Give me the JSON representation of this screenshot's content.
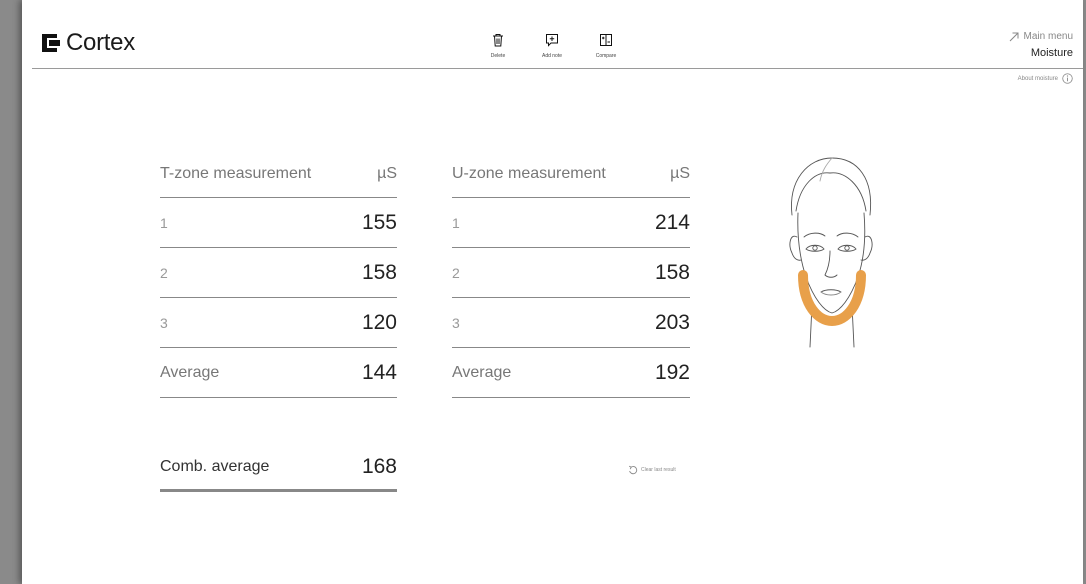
{
  "app": {
    "name": "Cortex"
  },
  "toolbar": {
    "delete_label": "Delete",
    "add_note_label": "Add note",
    "compare_label": "Compare"
  },
  "nav": {
    "main_menu_label": "Main menu",
    "page_title": "Moisture",
    "about_label": "About moisture"
  },
  "t_zone": {
    "title": "T-zone measurement",
    "unit": "µS",
    "rows": [
      {
        "label": "1",
        "value": "155"
      },
      {
        "label": "2",
        "value": "158"
      },
      {
        "label": "3",
        "value": "120"
      }
    ],
    "average_label": "Average",
    "average_value": "144"
  },
  "u_zone": {
    "title": "U-zone measurement",
    "unit": "µS",
    "rows": [
      {
        "label": "1",
        "value": "214"
      },
      {
        "label": "2",
        "value": "158"
      },
      {
        "label": "3",
        "value": "203"
      }
    ],
    "average_label": "Average",
    "average_value": "192"
  },
  "combined": {
    "label": "Comb. average",
    "value": "168"
  },
  "clear_label": "Clear last result",
  "icons": {
    "logo": "cortex-logo-icon",
    "delete": "trash-icon",
    "add_note": "add-note-icon",
    "compare": "compare-icon",
    "main_menu": "arrow-up-right-icon",
    "about": "info-icon",
    "clear": "undo-icon"
  },
  "colors": {
    "u_zone_highlight": "#E8A04A",
    "divider": "#888888",
    "text": "#222222"
  }
}
